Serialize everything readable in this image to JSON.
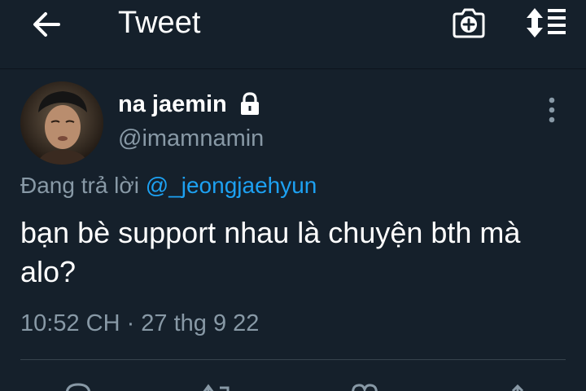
{
  "appbar": {
    "title": "Tweet"
  },
  "icons": {
    "back": "arrow-left-icon",
    "camera": "camera-plus-icon",
    "sort": "sort-list-icon",
    "lock": "lock-icon",
    "more": "more-vertical-icon",
    "reply": "reply-icon",
    "retweet": "retweet-icon",
    "like": "heart-icon",
    "share": "share-icon"
  },
  "tweet": {
    "display_name": "na jaemin",
    "handle": "@imamnamin",
    "reply_prefix": "Đang trả lời ",
    "reply_to": "@_jeongjaehyun",
    "text": "bạn bè support nhau là chuyện bth mà alo?",
    "timestamp": "10:52 CH · 27 thg 9 22"
  },
  "colors": {
    "background": "#15202b",
    "text_primary": "#ffffff",
    "text_secondary": "#8899a6",
    "accent": "#1da1f2",
    "divider": "#38444d"
  }
}
